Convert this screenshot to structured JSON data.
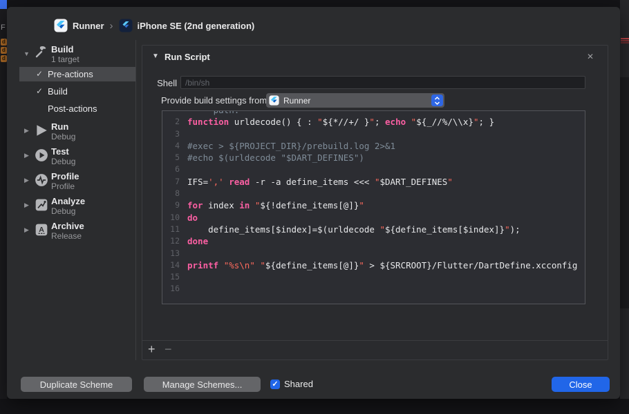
{
  "colors": {
    "keyword": "#fc5fa3",
    "string": "#fc6a5d",
    "comment": "#7f8c98",
    "plain": "#e7e8ea",
    "accent_blue": "#2166e8"
  },
  "background": {
    "partial_letter": "F",
    "file_badges": [
      "d",
      "d",
      "d"
    ]
  },
  "breadcrumb": {
    "scheme": "Runner",
    "separator": "›",
    "destination": "iPhone SE (2nd generation)"
  },
  "sidebar": {
    "build_group": {
      "label": "Build",
      "subtitle": "1 target"
    },
    "build_children": [
      {
        "label": "Pre-actions",
        "check": "✓"
      },
      {
        "label": "Build",
        "check": "✓"
      },
      {
        "label": "Post-actions",
        "check": ""
      }
    ],
    "actions": [
      {
        "label": "Run",
        "subtitle": "Debug"
      },
      {
        "label": "Test",
        "subtitle": "Debug"
      },
      {
        "label": "Profile",
        "subtitle": "Profile"
      },
      {
        "label": "Analyze",
        "subtitle": "Debug"
      },
      {
        "label": "Archive",
        "subtitle": "Release"
      }
    ]
  },
  "panel": {
    "title": "Run Script",
    "close_icon": "✕",
    "shell_label": "Shell",
    "shell_placeholder": "/bin/sh",
    "provide_label": "Provide build settings from",
    "provide_value": "Runner",
    "add_label": "+",
    "remove_label": "−"
  },
  "editor": {
    "clipped_line": {
      "text": "     path."
    },
    "lines": [
      {
        "n": 2,
        "tokens": [
          {
            "t": "function",
            "c": "k"
          },
          {
            "t": " urldecode() { : ",
            "c": "p"
          },
          {
            "t": "\"",
            "c": "s"
          },
          {
            "t": "${*//+/ }",
            "c": "p"
          },
          {
            "t": "\"",
            "c": "s"
          },
          {
            "t": "; ",
            "c": "p"
          },
          {
            "t": "echo",
            "c": "k"
          },
          {
            "t": " ",
            "c": "p"
          },
          {
            "t": "\"",
            "c": "s"
          },
          {
            "t": "${_//%/\\\\x}",
            "c": "p"
          },
          {
            "t": "\"",
            "c": "s"
          },
          {
            "t": "; }",
            "c": "p"
          }
        ]
      },
      {
        "n": 3,
        "tokens": []
      },
      {
        "n": 4,
        "tokens": [
          {
            "t": "#exec > ${PROJECT_DIR}/prebuild.log 2>&1",
            "c": "c"
          }
        ]
      },
      {
        "n": 5,
        "tokens": [
          {
            "t": "#echo $(urldecode \"$DART_DEFINES\")",
            "c": "c"
          }
        ]
      },
      {
        "n": 6,
        "tokens": []
      },
      {
        "n": 7,
        "tokens": [
          {
            "t": "IFS=",
            "c": "p"
          },
          {
            "t": "','",
            "c": "s"
          },
          {
            "t": " ",
            "c": "p"
          },
          {
            "t": "read",
            "c": "k"
          },
          {
            "t": " -r -a define_items <<< ",
            "c": "p"
          },
          {
            "t": "\"",
            "c": "s"
          },
          {
            "t": "$DART_DEFINES",
            "c": "p"
          },
          {
            "t": "\"",
            "c": "s"
          }
        ]
      },
      {
        "n": 8,
        "tokens": []
      },
      {
        "n": 9,
        "tokens": [
          {
            "t": "for",
            "c": "k"
          },
          {
            "t": " index ",
            "c": "p"
          },
          {
            "t": "in",
            "c": "k"
          },
          {
            "t": " ",
            "c": "p"
          },
          {
            "t": "\"",
            "c": "s"
          },
          {
            "t": "${!define_items[@]}",
            "c": "p"
          },
          {
            "t": "\"",
            "c": "s"
          }
        ]
      },
      {
        "n": 10,
        "tokens": [
          {
            "t": "do",
            "c": "k"
          }
        ]
      },
      {
        "n": 11,
        "tokens": [
          {
            "t": "    define_items[$index]=$(urldecode ",
            "c": "p"
          },
          {
            "t": "\"",
            "c": "s"
          },
          {
            "t": "${define_items[$index]}",
            "c": "p"
          },
          {
            "t": "\"",
            "c": "s"
          },
          {
            "t": ");",
            "c": "p"
          }
        ]
      },
      {
        "n": 12,
        "tokens": [
          {
            "t": "done",
            "c": "k"
          }
        ]
      },
      {
        "n": 13,
        "tokens": []
      },
      {
        "n": 14,
        "tokens": [
          {
            "t": "printf",
            "c": "k"
          },
          {
            "t": " ",
            "c": "p"
          },
          {
            "t": "\"%s\\n\"",
            "c": "s"
          },
          {
            "t": " ",
            "c": "p"
          },
          {
            "t": "\"",
            "c": "s"
          },
          {
            "t": "${define_items[@]}",
            "c": "p"
          },
          {
            "t": "\"",
            "c": "s"
          },
          {
            "t": " > ${SRCROOT}/Flutter/DartDefine.xcconfig",
            "c": "p"
          }
        ]
      },
      {
        "n": 15,
        "tokens": []
      },
      {
        "n": 16,
        "tokens": []
      }
    ]
  },
  "footer": {
    "duplicate_label": "Duplicate Scheme",
    "manage_label": "Manage Schemes...",
    "shared_label": "Shared",
    "shared_check": "✓",
    "close_label": "Close"
  }
}
